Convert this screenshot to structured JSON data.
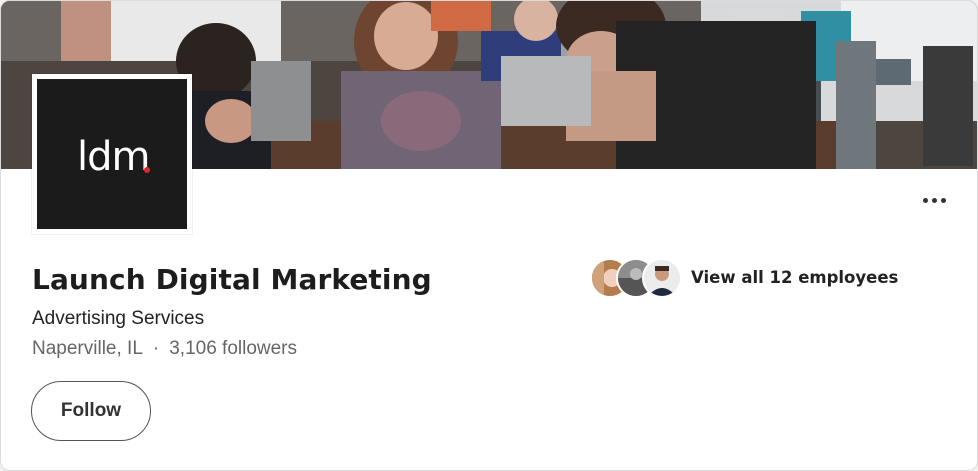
{
  "company": {
    "name": "Launch Digital Marketing",
    "industry": "Advertising Services",
    "location": "Naperville, IL",
    "separator": "·",
    "followers": "3,106 followers",
    "logo_text": "ldm",
    "logo_accent": "#e2232e"
  },
  "actions": {
    "follow_label": "Follow",
    "more_icon": "more-horizontal-icon"
  },
  "employees": {
    "label": "View all 12 employees"
  },
  "colors": {
    "logo_bg": "#1c1b1b",
    "text_primary": "#1d1d1d",
    "text_secondary": "#666666"
  }
}
